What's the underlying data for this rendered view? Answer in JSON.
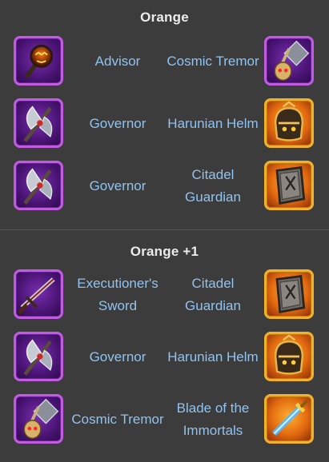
{
  "sections": [
    {
      "title": "Orange",
      "rows": [
        {
          "left": {
            "name": "Advisor",
            "icon": "advisor-icon"
          },
          "right": {
            "name": "Cosmic Tremor",
            "icon": "cosmic-tremor-icon"
          }
        },
        {
          "left": {
            "name": "Governor",
            "icon": "governor-icon"
          },
          "right": {
            "name": "Harunian Helm",
            "icon": "harunian-helm-icon"
          }
        },
        {
          "left": {
            "name": "Governor",
            "icon": "governor-icon"
          },
          "right": {
            "name": "Citadel Guardian",
            "icon": "citadel-guardian-icon"
          }
        }
      ]
    },
    {
      "title": "Orange +1",
      "rows": [
        {
          "left": {
            "name": "Executioner's Sword",
            "icon": "executioners-sword-icon"
          },
          "right": {
            "name": "Citadel Guardian",
            "icon": "citadel-guardian-icon"
          }
        },
        {
          "left": {
            "name": "Governor",
            "icon": "governor-icon"
          },
          "right": {
            "name": "Harunian Helm",
            "icon": "harunian-helm-icon"
          }
        },
        {
          "left": {
            "name": "Cosmic Tremor",
            "icon": "cosmic-tremor-icon"
          },
          "right": {
            "name": "Blade of the Immortals",
            "icon": "blade-of-the-immortals-icon"
          }
        }
      ]
    }
  ],
  "colors": {
    "background": "#3c3c3c",
    "title": "#ececec",
    "item_name": "#8ec3f2",
    "purple_frame": "#c15ce0",
    "gold_frame": "#f0b22a"
  }
}
